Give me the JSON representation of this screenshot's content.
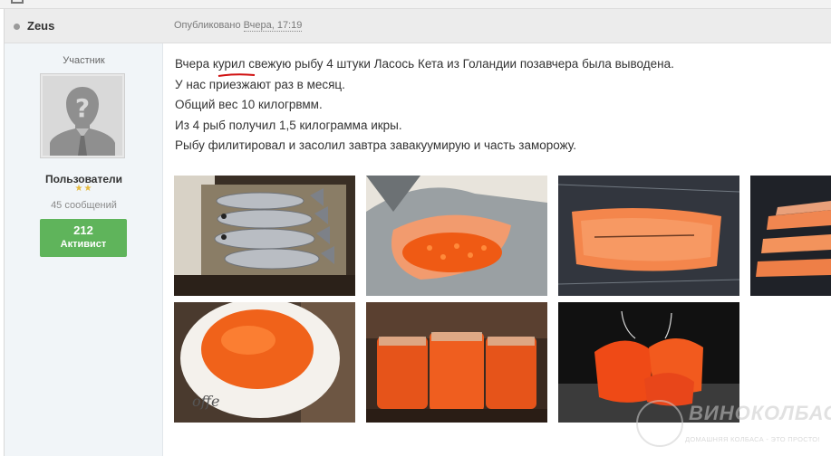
{
  "post": {
    "author": "Zeus",
    "published_prefix": "Опубликовано",
    "published_date": "Вчера, 17:19"
  },
  "profile": {
    "group": "Участник",
    "role": "Пользователи",
    "stars": "★★",
    "messages": "45 сообщений",
    "reputation_value": "212",
    "reputation_label": "Активист"
  },
  "body": {
    "lines": [
      "Вчера курил свежую рыбу 4 штуки Ласось Кета из Голандии позавчера была выводена.",
      "У нас приезжают раз в месяц.",
      "Общий вес 10 килогрвмм.",
      "Из 4 рыб получил 1,5 килограмма икры.",
      "Рыбу филитировал и засолил завтра завакуумирую и часть заморожу."
    ]
  },
  "watermark": {
    "title": "ВИНОКОЛБАСКИ",
    "subtitle": "ДОМАШНЯЯ КОЛБАСА - ЭТО ПРОСТО!"
  },
  "colors": {
    "header_bg": "#ececec",
    "sidebar_bg": "#f1f5f8",
    "badge_green": "#5fb45b",
    "star_gold": "#e5b93c",
    "caviar_orange": "#f0621a"
  }
}
